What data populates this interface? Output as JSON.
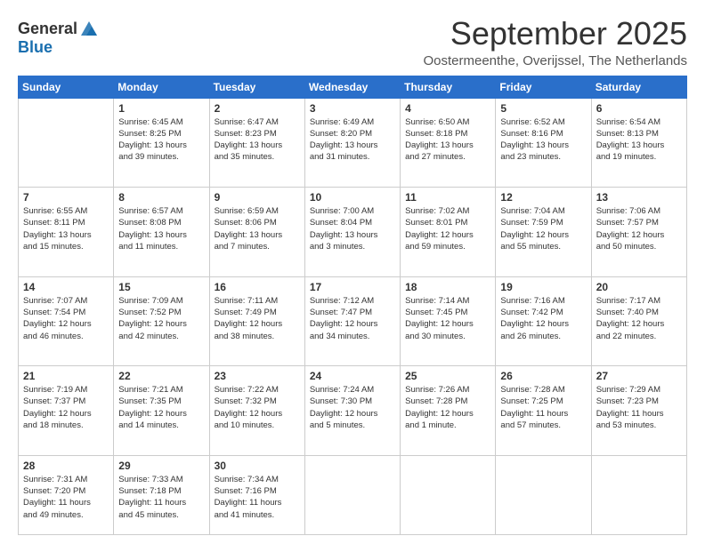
{
  "header": {
    "logo_general": "General",
    "logo_blue": "Blue",
    "title": "September 2025",
    "location": "Oostermeenthe, Overijssel, The Netherlands"
  },
  "days_of_week": [
    "Sunday",
    "Monday",
    "Tuesday",
    "Wednesday",
    "Thursday",
    "Friday",
    "Saturday"
  ],
  "weeks": [
    [
      {
        "day": "",
        "content": ""
      },
      {
        "day": "1",
        "content": "Sunrise: 6:45 AM\nSunset: 8:25 PM\nDaylight: 13 hours\nand 39 minutes."
      },
      {
        "day": "2",
        "content": "Sunrise: 6:47 AM\nSunset: 8:23 PM\nDaylight: 13 hours\nand 35 minutes."
      },
      {
        "day": "3",
        "content": "Sunrise: 6:49 AM\nSunset: 8:20 PM\nDaylight: 13 hours\nand 31 minutes."
      },
      {
        "day": "4",
        "content": "Sunrise: 6:50 AM\nSunset: 8:18 PM\nDaylight: 13 hours\nand 27 minutes."
      },
      {
        "day": "5",
        "content": "Sunrise: 6:52 AM\nSunset: 8:16 PM\nDaylight: 13 hours\nand 23 minutes."
      },
      {
        "day": "6",
        "content": "Sunrise: 6:54 AM\nSunset: 8:13 PM\nDaylight: 13 hours\nand 19 minutes."
      }
    ],
    [
      {
        "day": "7",
        "content": "Sunrise: 6:55 AM\nSunset: 8:11 PM\nDaylight: 13 hours\nand 15 minutes."
      },
      {
        "day": "8",
        "content": "Sunrise: 6:57 AM\nSunset: 8:08 PM\nDaylight: 13 hours\nand 11 minutes."
      },
      {
        "day": "9",
        "content": "Sunrise: 6:59 AM\nSunset: 8:06 PM\nDaylight: 13 hours\nand 7 minutes."
      },
      {
        "day": "10",
        "content": "Sunrise: 7:00 AM\nSunset: 8:04 PM\nDaylight: 13 hours\nand 3 minutes."
      },
      {
        "day": "11",
        "content": "Sunrise: 7:02 AM\nSunset: 8:01 PM\nDaylight: 12 hours\nand 59 minutes."
      },
      {
        "day": "12",
        "content": "Sunrise: 7:04 AM\nSunset: 7:59 PM\nDaylight: 12 hours\nand 55 minutes."
      },
      {
        "day": "13",
        "content": "Sunrise: 7:06 AM\nSunset: 7:57 PM\nDaylight: 12 hours\nand 50 minutes."
      }
    ],
    [
      {
        "day": "14",
        "content": "Sunrise: 7:07 AM\nSunset: 7:54 PM\nDaylight: 12 hours\nand 46 minutes."
      },
      {
        "day": "15",
        "content": "Sunrise: 7:09 AM\nSunset: 7:52 PM\nDaylight: 12 hours\nand 42 minutes."
      },
      {
        "day": "16",
        "content": "Sunrise: 7:11 AM\nSunset: 7:49 PM\nDaylight: 12 hours\nand 38 minutes."
      },
      {
        "day": "17",
        "content": "Sunrise: 7:12 AM\nSunset: 7:47 PM\nDaylight: 12 hours\nand 34 minutes."
      },
      {
        "day": "18",
        "content": "Sunrise: 7:14 AM\nSunset: 7:45 PM\nDaylight: 12 hours\nand 30 minutes."
      },
      {
        "day": "19",
        "content": "Sunrise: 7:16 AM\nSunset: 7:42 PM\nDaylight: 12 hours\nand 26 minutes."
      },
      {
        "day": "20",
        "content": "Sunrise: 7:17 AM\nSunset: 7:40 PM\nDaylight: 12 hours\nand 22 minutes."
      }
    ],
    [
      {
        "day": "21",
        "content": "Sunrise: 7:19 AM\nSunset: 7:37 PM\nDaylight: 12 hours\nand 18 minutes."
      },
      {
        "day": "22",
        "content": "Sunrise: 7:21 AM\nSunset: 7:35 PM\nDaylight: 12 hours\nand 14 minutes."
      },
      {
        "day": "23",
        "content": "Sunrise: 7:22 AM\nSunset: 7:32 PM\nDaylight: 12 hours\nand 10 minutes."
      },
      {
        "day": "24",
        "content": "Sunrise: 7:24 AM\nSunset: 7:30 PM\nDaylight: 12 hours\nand 5 minutes."
      },
      {
        "day": "25",
        "content": "Sunrise: 7:26 AM\nSunset: 7:28 PM\nDaylight: 12 hours\nand 1 minute."
      },
      {
        "day": "26",
        "content": "Sunrise: 7:28 AM\nSunset: 7:25 PM\nDaylight: 11 hours\nand 57 minutes."
      },
      {
        "day": "27",
        "content": "Sunrise: 7:29 AM\nSunset: 7:23 PM\nDaylight: 11 hours\nand 53 minutes."
      }
    ],
    [
      {
        "day": "28",
        "content": "Sunrise: 7:31 AM\nSunset: 7:20 PM\nDaylight: 11 hours\nand 49 minutes."
      },
      {
        "day": "29",
        "content": "Sunrise: 7:33 AM\nSunset: 7:18 PM\nDaylight: 11 hours\nand 45 minutes."
      },
      {
        "day": "30",
        "content": "Sunrise: 7:34 AM\nSunset: 7:16 PM\nDaylight: 11 hours\nand 41 minutes."
      },
      {
        "day": "",
        "content": ""
      },
      {
        "day": "",
        "content": ""
      },
      {
        "day": "",
        "content": ""
      },
      {
        "day": "",
        "content": ""
      }
    ]
  ]
}
